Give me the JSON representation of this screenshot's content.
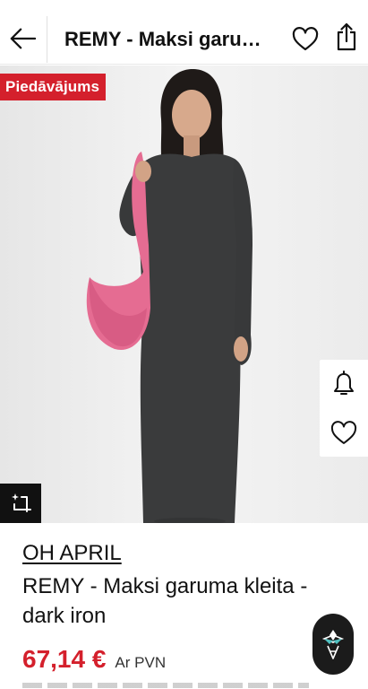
{
  "header": {
    "title": "REMY - Maksi garuma kleita - dark iron",
    "back_icon": "arrow-left-icon",
    "favorite_icon": "heart-icon",
    "share_icon": "share-icon"
  },
  "product_image": {
    "badge": "Piedāvājums",
    "badge_color": "#d4202c",
    "alt": "Model wearing dark grey long-sleeve maxi dress holding a pink bag"
  },
  "side_actions": {
    "alert_icon": "bell-icon",
    "wishlist_icon": "heart-icon"
  },
  "compare_icon": "sparkle-crop-icon",
  "product": {
    "brand": "OH APRIL",
    "name": "REMY - Maksi garuma kleita - dark iron",
    "price": "67,14 €",
    "vat_note": "Ar PVN",
    "price_color": "#d4202c"
  },
  "assistant_icon": "assistant-logo-icon"
}
